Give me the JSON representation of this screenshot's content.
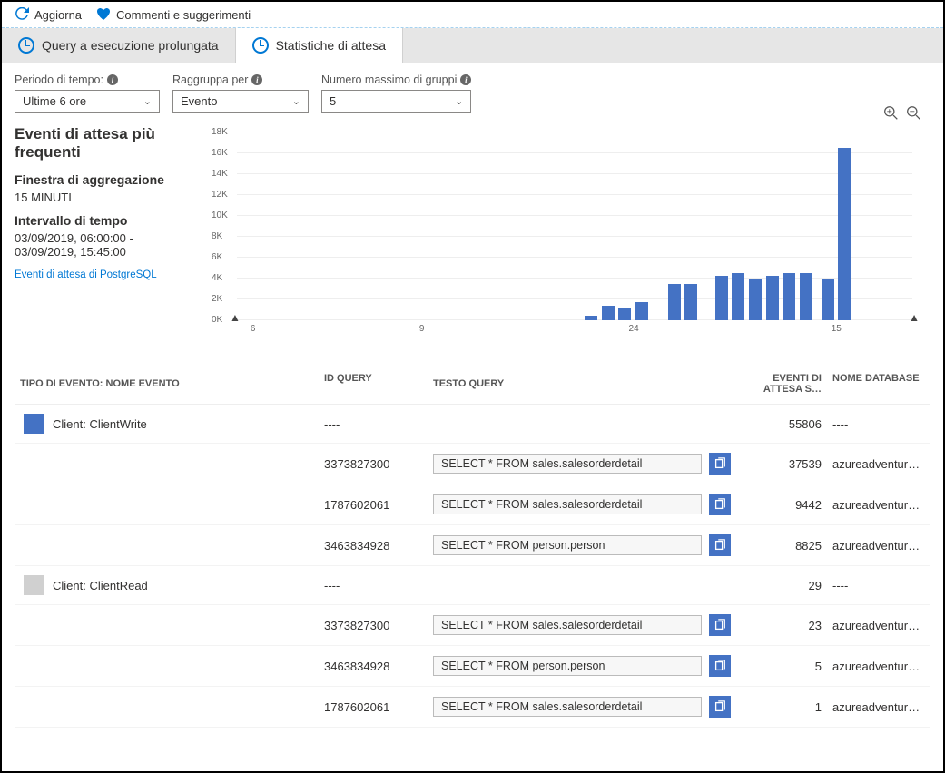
{
  "toolbar": {
    "refresh_label": "Aggiorna",
    "feedback_label": "Commenti e suggerimenti"
  },
  "tabs": {
    "long_running_label": "Query a esecuzione prolungata",
    "wait_stats_label": "Statistiche di attesa"
  },
  "filters": {
    "time_period_label": "Periodo di tempo:",
    "time_period_value": "Ultime 6 ore",
    "group_by_label": "Raggruppa per",
    "group_by_value": "Evento",
    "max_groups_label": "Numero massimo di gruppi",
    "max_groups_value": "5"
  },
  "side": {
    "title": "Eventi di attesa più frequenti",
    "agg_window_label": "Finestra di aggregazione",
    "agg_window_value": "15 MINUTI",
    "time_range_label": "Intervallo di tempo",
    "time_range_value": "03/09/2019, 06:00:00 - 03/09/2019, 15:45:00",
    "link_text": "Eventi di attesa di PostgreSQL"
  },
  "chart_data": {
    "type": "bar",
    "ylabel": "",
    "xlabel": "",
    "ylim": [
      0,
      18000
    ],
    "y_ticks": [
      "0K",
      "2K",
      "4K",
      "6K",
      "8K",
      "10K",
      "12K",
      "14K",
      "16K",
      "18K"
    ],
    "x_ticks": [
      "6",
      "9",
      "24",
      "15"
    ],
    "x_tick_pos_pct": [
      2,
      27,
      58,
      88
    ],
    "bars": [
      {
        "x_pct": 51.5,
        "value": 400
      },
      {
        "x_pct": 54.0,
        "value": 1400
      },
      {
        "x_pct": 56.5,
        "value": 1100
      },
      {
        "x_pct": 59.0,
        "value": 1700
      },
      {
        "x_pct": 63.8,
        "value": 3500
      },
      {
        "x_pct": 66.3,
        "value": 3500
      },
      {
        "x_pct": 70.8,
        "value": 4300
      },
      {
        "x_pct": 73.3,
        "value": 4500
      },
      {
        "x_pct": 75.8,
        "value": 3900
      },
      {
        "x_pct": 78.3,
        "value": 4300
      },
      {
        "x_pct": 80.8,
        "value": 4500
      },
      {
        "x_pct": 83.3,
        "value": 4500
      },
      {
        "x_pct": 86.5,
        "value": 3900
      },
      {
        "x_pct": 89.0,
        "value": 16500
      }
    ]
  },
  "table": {
    "headers": {
      "type": "TIPO DI EVENTO: NOME EVENTO",
      "id": "ID QUERY",
      "text": "TESTO QUERY",
      "wait": "EVENTI DI ATTESA S…",
      "db": "NOME DATABASE"
    },
    "dash": "----",
    "groups": [
      {
        "color": "blue",
        "name": "Client: ClientWrite",
        "total": "55806",
        "rows": [
          {
            "id": "3373827300",
            "text": "SELECT * FROM sales.salesorderdetail",
            "wait": "37539",
            "db": "azureadventurewor…"
          },
          {
            "id": "1787602061",
            "text": "SELECT * FROM sales.salesorderdetail",
            "wait": "9442",
            "db": "azureadventurewor…"
          },
          {
            "id": "3463834928",
            "text": "SELECT * FROM person.person",
            "wait": "8825",
            "db": "azureadventurewor…"
          }
        ]
      },
      {
        "color": "grey",
        "name": "Client: ClientRead",
        "total": "29",
        "rows": [
          {
            "id": "3373827300",
            "text": "SELECT * FROM sales.salesorderdetail",
            "wait": "23",
            "db": "azureadventurewor…"
          },
          {
            "id": "3463834928",
            "text": "SELECT * FROM person.person",
            "wait": "5",
            "db": "azureadventurewor…"
          },
          {
            "id": "1787602061",
            "text": "SELECT * FROM sales.salesorderdetail",
            "wait": "1",
            "db": "azureadventurewor…"
          }
        ]
      }
    ]
  }
}
